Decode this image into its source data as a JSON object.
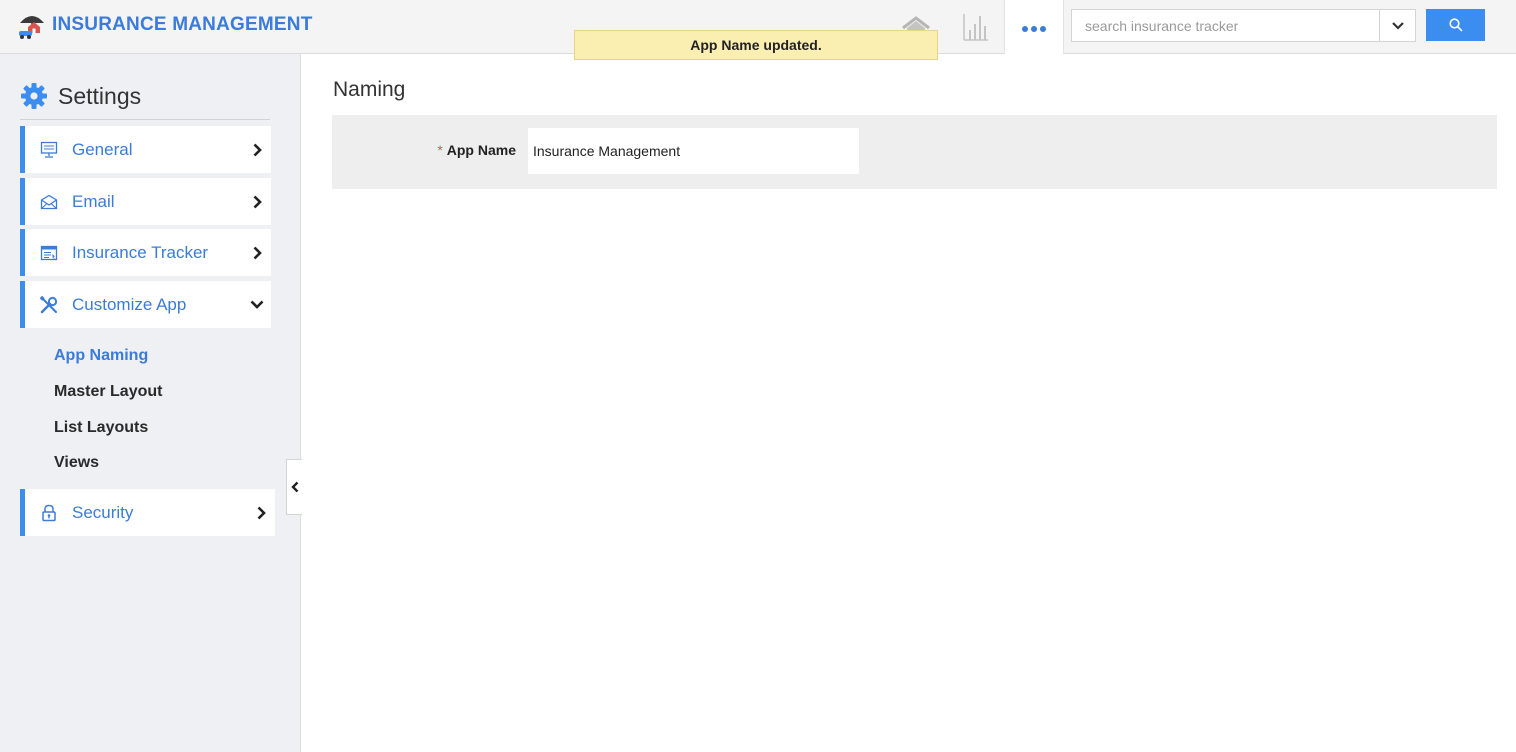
{
  "header": {
    "app_title": "INSURANCE MANAGEMENT",
    "icons": {
      "logo": "insurance-logo-icon",
      "home": "home-icon",
      "reports": "bar-chart-icon",
      "more": "more-dots-icon",
      "dropdown": "chevron-down-icon",
      "search": "search-icon"
    },
    "search": {
      "placeholder": "search insurance tracker",
      "value": ""
    },
    "accent_color": "#3b7bd9",
    "search_button_color": "#3b8df0"
  },
  "notification": {
    "message": "App Name updated.",
    "background": "#fbeeb1"
  },
  "sidebar": {
    "heading": "Settings",
    "heading_icon": "gear-icon",
    "items": [
      {
        "label": "General",
        "icon": "monitor-icon",
        "state": "collapsed"
      },
      {
        "label": "Email",
        "icon": "envelope-icon",
        "state": "collapsed"
      },
      {
        "label": "Insurance Tracker",
        "icon": "form-window-icon",
        "state": "collapsed"
      },
      {
        "label": "Customize App",
        "icon": "tools-icon",
        "state": "expanded"
      },
      {
        "label": "Security",
        "icon": "lock-icon",
        "state": "collapsed"
      }
    ],
    "sub_items": [
      {
        "label": "App Naming",
        "active": true
      },
      {
        "label": "Master Layout",
        "active": false
      },
      {
        "label": "List Layouts",
        "active": false
      },
      {
        "label": "Views",
        "active": false
      }
    ],
    "collapse_icon": "chevron-left-icon"
  },
  "main": {
    "title": "Naming",
    "form": {
      "required_marker": "*",
      "app_name_label": "App Name",
      "app_name_value": "Insurance Management"
    }
  }
}
